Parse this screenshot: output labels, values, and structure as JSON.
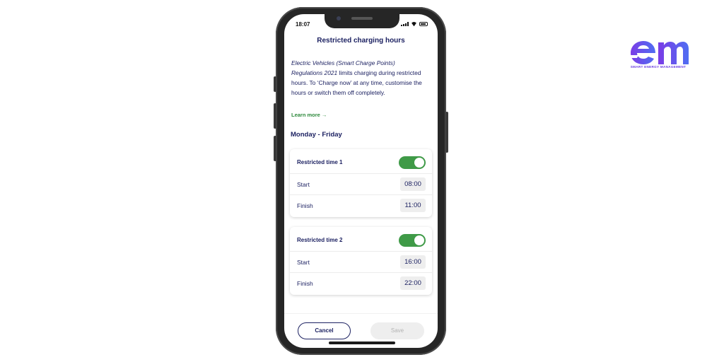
{
  "status_bar": {
    "time": "18:07"
  },
  "screen": {
    "title": "Restricted charging hours",
    "description": {
      "regulation": "Electric Vehicles (Smart Charge Points) Regulations 2021",
      "text": " limits charging during restricted hours. To ‘Charge now’ at any time, customise the hours or switch them off completely."
    },
    "learn_more": "Learn more →",
    "section_title": "Monday - Friday",
    "restricted_times": [
      {
        "label": "Restricted time 1",
        "enabled": true,
        "start_label": "Start",
        "start": "08:00",
        "finish_label": "Finish",
        "finish": "11:00"
      },
      {
        "label": "Restricted time 2",
        "enabled": true,
        "start_label": "Start",
        "start": "16:00",
        "finish_label": "Finish",
        "finish": "22:00"
      }
    ],
    "cancel_label": "Cancel",
    "save_label": "Save"
  },
  "brand": {
    "logo_text": "em",
    "tagline": "SMART ENERGY MANAGEMENT"
  },
  "colors": {
    "navy": "#1d2262",
    "toggle_on": "#3f9a47",
    "link_green": "#2f8a3d",
    "brand_purple": "#6a3de0",
    "brand_blue": "#5a6cf0"
  }
}
